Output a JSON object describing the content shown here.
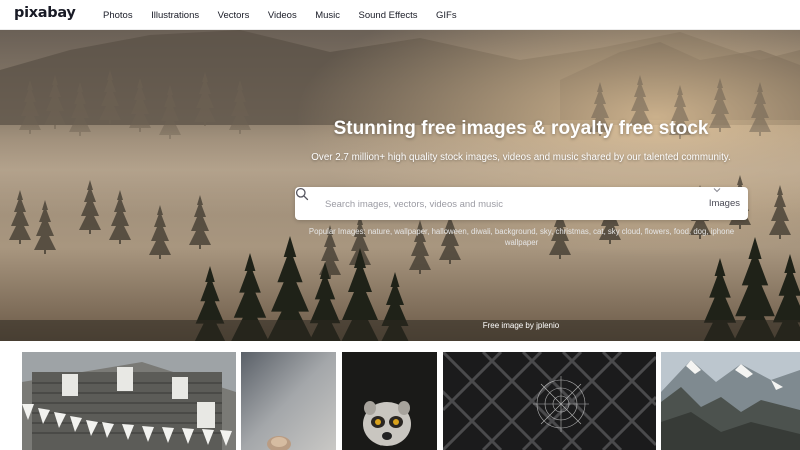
{
  "brand": {
    "logo_text": "pixabay"
  },
  "nav": {
    "items": [
      {
        "label": "Photos"
      },
      {
        "label": "Illustrations"
      },
      {
        "label": "Vectors"
      },
      {
        "label": "Videos"
      },
      {
        "label": "Music"
      },
      {
        "label": "Sound Effects"
      },
      {
        "label": "GIFs"
      }
    ]
  },
  "hero": {
    "title": "Stunning free images & royalty free stock",
    "subtitle": "Over 2.7 million+ high quality stock images, videos and music shared by our talented community.",
    "search": {
      "placeholder": "Search images, vectors, videos and music",
      "value": "",
      "icon": "search-icon",
      "type_selected": "Images",
      "type_icon": "chevron-down-icon"
    },
    "popular_label": "Popular Images:",
    "popular_tags": [
      "nature",
      "wallpaper",
      "halloween",
      "diwali",
      "background",
      "sky",
      "christmas",
      "cat",
      "sky cloud",
      "flowers",
      "food",
      "dog",
      "iphone wallpaper"
    ],
    "credit": "Free image by jplenio"
  },
  "colors": {
    "text": "#191b26",
    "hero_sky": "#857868",
    "hero_fog": "#b8a68f",
    "tree_dark": "#1f2218",
    "search_bg": "#ffffff"
  }
}
